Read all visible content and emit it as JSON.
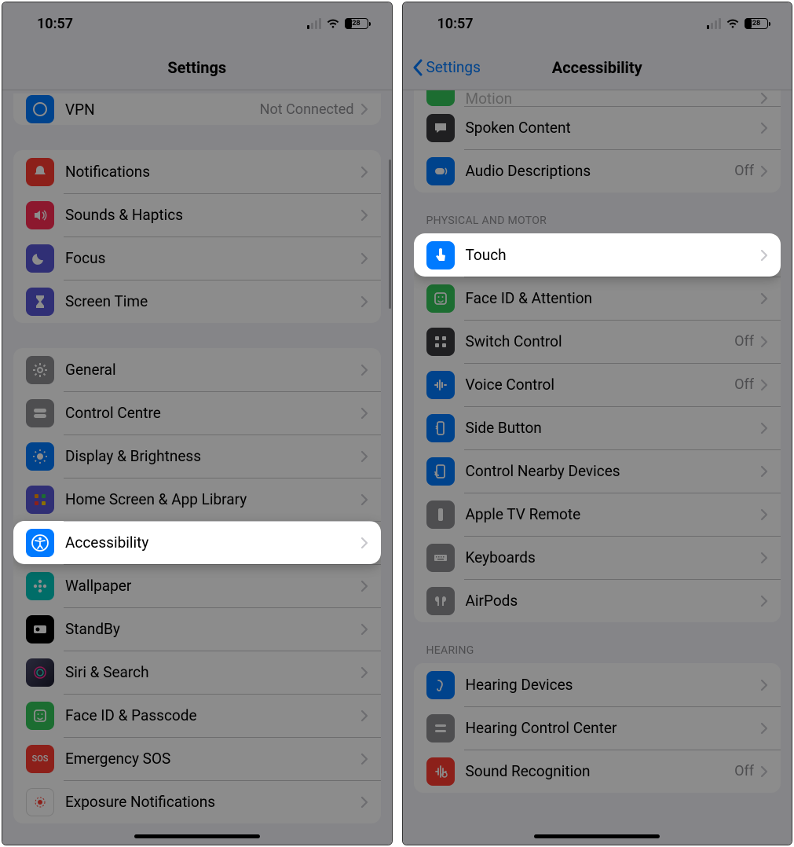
{
  "status_time": "10:57",
  "battery_level": "28",
  "phone1": {
    "nav_title": "Settings",
    "partial_row": {
      "label": "VPN",
      "detail": "Not Connected",
      "icon_bg": "#007aff"
    },
    "group1": [
      {
        "label": "Notifications",
        "icon_bg": "#ff3b30"
      },
      {
        "label": "Sounds & Haptics",
        "icon_bg": "#ff2d55"
      },
      {
        "label": "Focus",
        "icon_bg": "#5856d6"
      },
      {
        "label": "Screen Time",
        "icon_bg": "#5856d6"
      }
    ],
    "group2": [
      {
        "label": "General",
        "icon_bg": "#8e8e93"
      },
      {
        "label": "Control Centre",
        "icon_bg": "#8e8e93"
      },
      {
        "label": "Display & Brightness",
        "icon_bg": "#007aff"
      },
      {
        "label": "Home Screen & App Library",
        "icon_bg": "#5856d6"
      },
      {
        "label": "Accessibility",
        "icon_bg": "#007aff",
        "highlight": true
      },
      {
        "label": "Wallpaper",
        "icon_bg": "#00c7be"
      },
      {
        "label": "StandBy",
        "icon_bg": "#000000"
      },
      {
        "label": "Siri & Search",
        "icon_bg": "#222222"
      },
      {
        "label": "Face ID & Passcode",
        "icon_bg": "#34c759"
      },
      {
        "label": "Emergency SOS",
        "icon_bg": "#ff3b30",
        "icon_text": "SOS"
      },
      {
        "label": "Exposure Notifications",
        "icon_bg": "#ffffff",
        "icon_fg": "#ff3b30"
      }
    ]
  },
  "phone2": {
    "back_label": "Settings",
    "nav_title": "Accessibility",
    "group_top": [
      {
        "label": "Motion",
        "icon_bg": "#34c759",
        "partial": true
      },
      {
        "label": "Spoken Content",
        "icon_bg": "#3a3a3c"
      },
      {
        "label": "Audio Descriptions",
        "icon_bg": "#007aff",
        "detail": "Off"
      }
    ],
    "section1_header": "PHYSICAL AND MOTOR",
    "group1": [
      {
        "label": "Touch",
        "icon_bg": "#007aff",
        "highlight": true
      },
      {
        "label": "Face ID & Attention",
        "icon_bg": "#34c759"
      },
      {
        "label": "Switch Control",
        "icon_bg": "#3a3a3c",
        "detail": "Off"
      },
      {
        "label": "Voice Control",
        "icon_bg": "#007aff",
        "detail": "Off"
      },
      {
        "label": "Side Button",
        "icon_bg": "#007aff"
      },
      {
        "label": "Control Nearby Devices",
        "icon_bg": "#007aff"
      },
      {
        "label": "Apple TV Remote",
        "icon_bg": "#8e8e93"
      },
      {
        "label": "Keyboards",
        "icon_bg": "#8e8e93"
      },
      {
        "label": "AirPods",
        "icon_bg": "#8e8e93"
      }
    ],
    "section2_header": "HEARING",
    "group2": [
      {
        "label": "Hearing Devices",
        "icon_bg": "#007aff"
      },
      {
        "label": "Hearing Control Center",
        "icon_bg": "#8e8e93"
      },
      {
        "label": "Sound Recognition",
        "icon_bg": "#ff3b30",
        "detail": "Off"
      }
    ]
  }
}
